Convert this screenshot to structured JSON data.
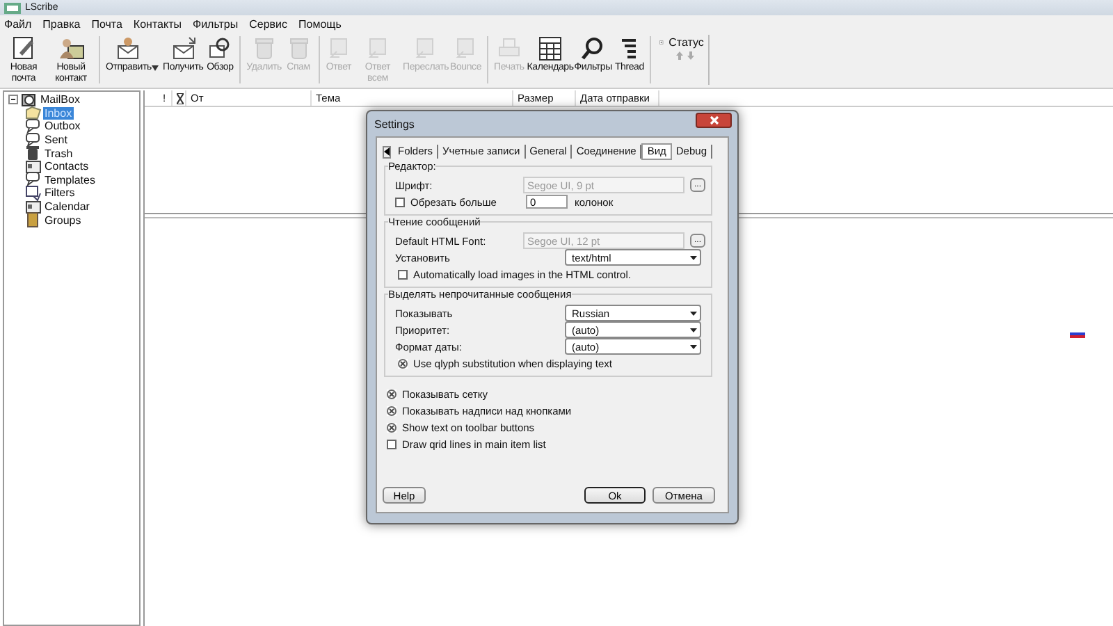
{
  "window": {
    "title": "LScribe"
  },
  "menu": [
    "Файл",
    "Правка",
    "Почта",
    "Контакты",
    "Фильтры",
    "Сервис",
    "Помощь"
  ],
  "toolbar": [
    {
      "kind": "button",
      "label": "Новая почта",
      "disabled": false
    },
    {
      "kind": "button",
      "label": "Новый контакт",
      "disabled": false
    },
    {
      "kind": "separator"
    },
    {
      "kind": "dropdown",
      "label": "Отправить",
      "disabled": false
    },
    {
      "kind": "button",
      "label": "Получить",
      "disabled": false
    },
    {
      "kind": "button",
      "label": "Обзор",
      "disabled": false
    },
    {
      "kind": "separator"
    },
    {
      "kind": "button",
      "label": "Удалить",
      "disabled": true
    },
    {
      "kind": "button",
      "label": "Спам",
      "disabled": true
    },
    {
      "kind": "separator"
    },
    {
      "kind": "button",
      "label": "Ответ",
      "disabled": true
    },
    {
      "kind": "button",
      "label": "Ответ всем",
      "disabled": true
    },
    {
      "kind": "button",
      "label": "Переслать",
      "disabled": true
    },
    {
      "kind": "button",
      "label": "Bounce",
      "disabled": true
    },
    {
      "kind": "separator"
    },
    {
      "kind": "button",
      "label": "Печать",
      "disabled": true
    },
    {
      "kind": "button",
      "label": "Календарь",
      "disabled": false
    },
    {
      "kind": "button",
      "label": "Фильтры",
      "disabled": false
    },
    {
      "kind": "button",
      "label": "Thread",
      "disabled": false
    },
    {
      "kind": "separator"
    },
    {
      "kind": "status",
      "label": "Статус"
    }
  ],
  "sidebar": {
    "items": [
      {
        "label": "MailBox",
        "expanded": true,
        "selected": false,
        "children": [
          {
            "label": "Inbox",
            "selected": true
          },
          {
            "label": "Outbox",
            "selected": false
          },
          {
            "label": "Sent",
            "selected": false
          },
          {
            "label": "Trash",
            "selected": false
          },
          {
            "label": "Contacts",
            "selected": false
          },
          {
            "label": "Templates",
            "selected": false
          },
          {
            "label": "Filters",
            "selected": false
          },
          {
            "label": "Calendar",
            "selected": false
          },
          {
            "label": "Groups",
            "selected": false
          }
        ]
      }
    ]
  },
  "table": {
    "columns": [
      {
        "kind": "text",
        "label": "!"
      },
      {
        "kind": "icon"
      },
      {
        "kind": "text",
        "label": "От"
      },
      {
        "kind": "text",
        "label": "Тема"
      },
      {
        "kind": "text",
        "label": "Размер"
      },
      {
        "kind": "text",
        "label": "Дата отправки"
      }
    ]
  },
  "dialog": {
    "title": "Settings",
    "tabs": [
      {
        "label": "Folders",
        "selected": false
      },
      {
        "label": "Учетные записи",
        "selected": false
      },
      {
        "label": "General",
        "selected": false
      },
      {
        "label": "Соединение",
        "selected": false
      },
      {
        "label": "Вид",
        "selected": true
      },
      {
        "label": "Debug",
        "selected": false
      }
    ],
    "groups": [
      {
        "title": "Редактор:",
        "rows": [
          {
            "kind": "font",
            "label": "Шрифт:",
            "value": "Segoe UI, 9 pt",
            "disabled": true,
            "button": "..."
          },
          {
            "kind": "check_input",
            "label": "Обрезать больше",
            "checked": false,
            "value": "0",
            "suffix": "колонок"
          }
        ]
      },
      {
        "title": "Чтение сообщений",
        "rows": [
          {
            "kind": "font",
            "label": "Default HTML Font:",
            "value": "Segoe UI, 12 pt",
            "disabled": true,
            "button": "..."
          },
          {
            "kind": "select",
            "label": "Установить",
            "value": "text/html"
          },
          {
            "kind": "check",
            "label": "Automatically load images in the HTML control.",
            "checked": false
          }
        ]
      },
      {
        "title": "Выделять непрочитанные сообщения",
        "rows": [
          {
            "kind": "select",
            "label": "Показывать",
            "value": "Russian"
          },
          {
            "kind": "select",
            "label": "Приоритет:",
            "value": "(auto)"
          },
          {
            "kind": "select",
            "label": "Формат даты:",
            "value": "(auto)"
          },
          {
            "kind": "check",
            "label": "Use qlyph substitution when displaying text",
            "checked": true
          }
        ]
      }
    ],
    "options": [
      {
        "label": "Показывать сетку",
        "checked": true
      },
      {
        "label": "Показывать надписи над кнопками",
        "checked": true
      },
      {
        "label": "Show text on toolbar buttons",
        "checked": true
      },
      {
        "label": "Draw qrid lines in main item list",
        "checked": false
      }
    ],
    "buttons": [
      {
        "label": "Help",
        "default": false
      },
      {
        "label": "Ok",
        "default": true
      },
      {
        "label": "Отмена",
        "default": false
      }
    ]
  }
}
